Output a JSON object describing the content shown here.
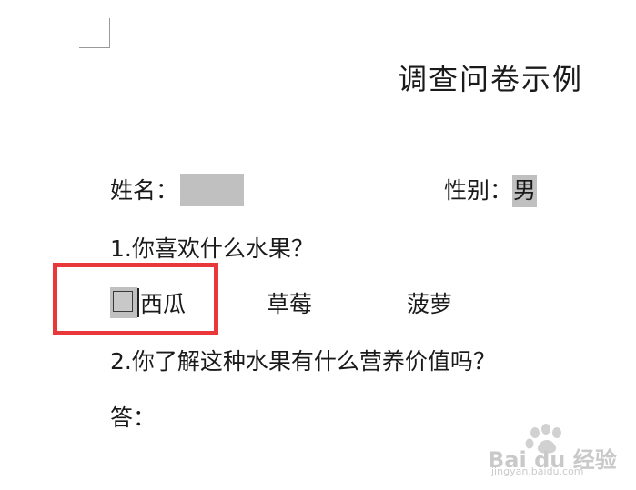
{
  "document": {
    "title": "调查问卷示例",
    "name_label": "姓名：",
    "name_value": "",
    "gender_label": "性别：",
    "gender_value": "男",
    "question1": "1.你喜欢什么水果？",
    "options": [
      "西瓜",
      "草莓",
      "菠萝"
    ],
    "question2": "2.你了解这种水果有什么营养价值吗？",
    "answer_label": "答："
  },
  "watermark": {
    "brand": "Bai du 经验",
    "site": "jingyan.baidu.com"
  },
  "colors": {
    "field_shade": "#c0c0c0",
    "highlight": "#e8383a"
  }
}
